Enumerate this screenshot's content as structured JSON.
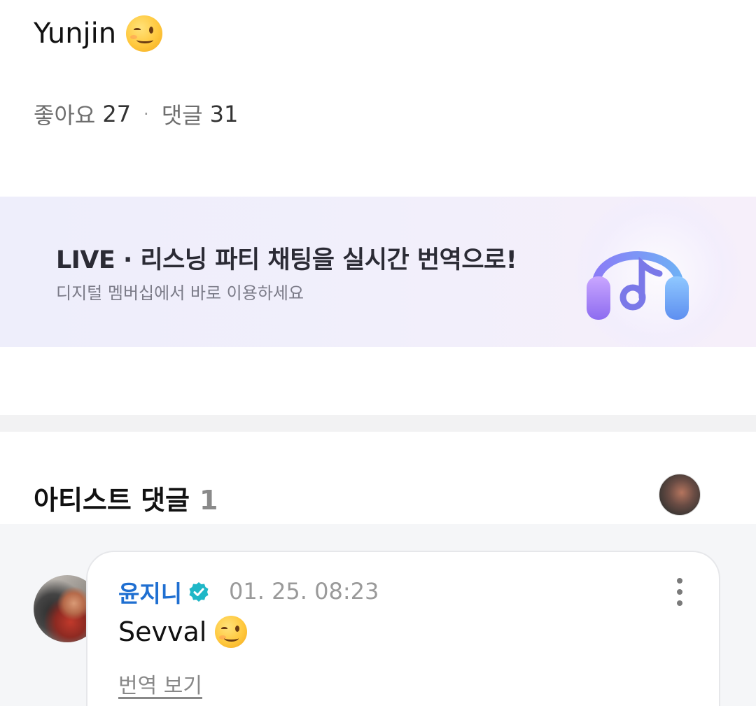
{
  "post": {
    "text": "Yunjin",
    "emoji": "winking-face-emoji"
  },
  "stats": {
    "likes_label": "좋아요",
    "likes_count": "27",
    "separator": "·",
    "comments_label": "댓글",
    "comments_count": "31"
  },
  "banner": {
    "title": "LIVE · 리스닝 파티 채팅을 실시간 번역으로!",
    "subtitle": "디지털 멤버십에서 바로 이용하세요",
    "icon": "headphone-music-icon"
  },
  "artist_comments": {
    "title": "아티스트 댓글",
    "count": "1"
  },
  "comment": {
    "author": "윤지니",
    "verified_icon": "verified-badge-icon",
    "timestamp": "01. 25. 08:23",
    "text": "Sevval",
    "emoji": "winking-face-emoji",
    "translate_label": "번역 보기",
    "more_icon": "more-vertical-icon"
  },
  "colors": {
    "author_blue": "#1f6fd1",
    "verified_teal": "#1fb7c7",
    "muted_gray": "#9a9a9a"
  }
}
